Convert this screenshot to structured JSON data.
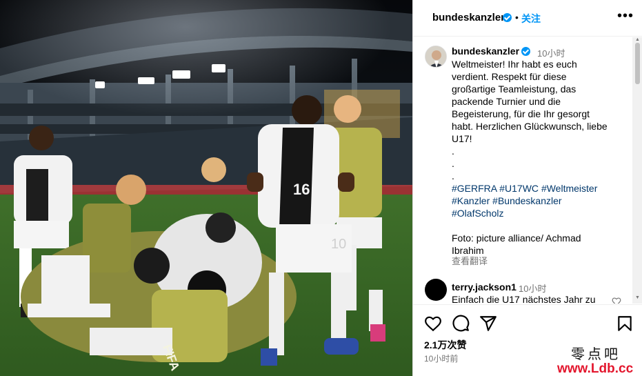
{
  "post": {
    "username": "bundeskanzler",
    "verified": true,
    "follow_label": "关注",
    "more_icon": "more-horizontal-icon"
  },
  "caption": {
    "username": "bundeskanzler",
    "time": "10小时",
    "lines": [
      "Weltmeister! Ihr habt es euch",
      "verdient. Respekt für diese",
      "großartige Teamleistung, das",
      "packende Turnier und die",
      "Begeisterung, für die Ihr gesorgt",
      "habt. Herzlichen Glückwunsch, liebe",
      "U17!",
      ".",
      ".",
      "."
    ],
    "hashtag_lines": [
      [
        "#GERFRA",
        "#U17WC",
        "#Weltmeister"
      ],
      [
        "#Kanzler",
        "#Bundeskanzler"
      ],
      [
        "#OlafScholz"
      ]
    ],
    "credit_lines": [
      "Foto: picture alliance/ Achmad",
      "Ibrahim"
    ],
    "translate_label": "查看翻译"
  },
  "comments": [
    {
      "username": "terry.jackson1",
      "time": "10小时",
      "text": "Einfach die U17 nächstes Jahr zu"
    }
  ],
  "actions": {
    "icons": [
      "heart-icon",
      "comment-icon",
      "share-icon",
      "bookmark-icon"
    ],
    "likes": "2.1万次赞",
    "posted": "10小时前"
  },
  "photo": {
    "jersey_numbers": [
      "16",
      "10"
    ],
    "bib_text": "FIFA"
  },
  "watermark": {
    "cn": "零点吧",
    "url": "www.Ldb.cc"
  }
}
